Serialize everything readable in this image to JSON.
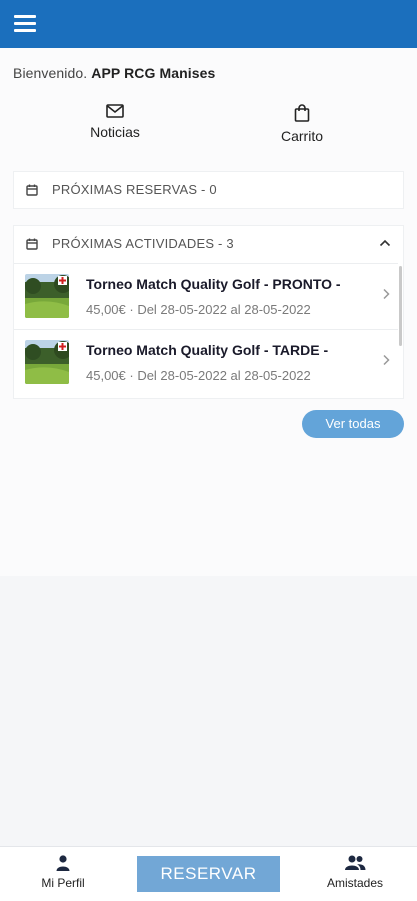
{
  "header": {
    "menu_icon": "hamburger-menu-icon",
    "color": "#1b6fbd"
  },
  "welcome": {
    "prefix": "Bienvenido. ",
    "club": "APP RCG Manises"
  },
  "quick_links": [
    {
      "label": "Noticias",
      "icon": "mail-icon"
    },
    {
      "label": "Carrito",
      "icon": "shopping-bag-icon"
    }
  ],
  "reservations": {
    "title": "PRÓXIMAS RESERVAS - 0",
    "icon": "calendar-icon"
  },
  "activities": {
    "title": "PRÓXIMAS ACTIVIDADES - 3",
    "icon": "calendar-icon",
    "items": [
      {
        "title": "Torneo Match Quality Golf - PRONTO -",
        "subtitle": "45,00€ · Del 28-05-2022 al 28-05-2022",
        "thumb": "golf-course-thumbnail"
      },
      {
        "title": "Torneo Match Quality Golf - TARDE -",
        "subtitle": "45,00€ · Del 28-05-2022 al 28-05-2022",
        "thumb": "golf-course-thumbnail"
      }
    ],
    "view_all": "Ver todas"
  },
  "bottom_bar": {
    "profile_label": "Mi Perfil",
    "reserve_label": "RESERVAR",
    "friends_label": "Amistades"
  },
  "colors": {
    "primary": "#1b6fbd",
    "button": "#63a4d9",
    "reserve_button": "#72a7d6"
  }
}
